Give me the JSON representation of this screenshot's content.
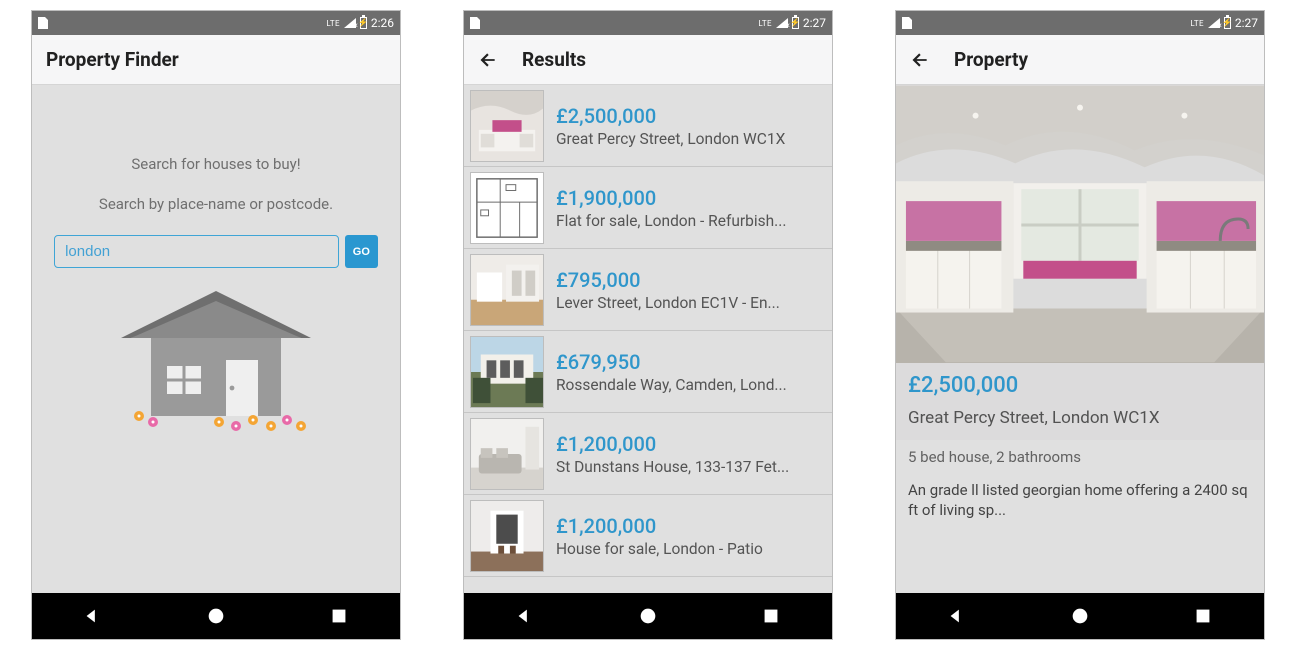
{
  "colors": {
    "accent": "#2f96cb",
    "statusbar": "#6d6d6d",
    "bg": "#e0e0e0"
  },
  "screen1": {
    "status_time": "2:26",
    "status_net": "LTE",
    "title": "Property Finder",
    "headline": "Search for houses to buy!",
    "subline": "Search by place-name or postcode.",
    "search_value": "london",
    "go_label": "GO"
  },
  "screen2": {
    "status_time": "2:27",
    "status_net": "LTE",
    "title": "Results",
    "items": [
      {
        "price": "£2,500,000",
        "address": "Great Percy Street, London WC1X"
      },
      {
        "price": "£1,900,000",
        "address": "Flat for sale, London - Refurbish..."
      },
      {
        "price": "£795,000",
        "address": "Lever Street, London EC1V - En..."
      },
      {
        "price": "£679,950",
        "address": "Rossendale Way, Camden, Lond..."
      },
      {
        "price": "£1,200,000",
        "address": "St Dunstans House, 133-137 Fet..."
      },
      {
        "price": "£1,200,000",
        "address": "House for sale, London - Patio"
      }
    ]
  },
  "screen3": {
    "status_time": "2:27",
    "status_net": "LTE",
    "title": "Property",
    "price": "£2,500,000",
    "address": "Great Percy Street, London WC1X",
    "summary": "5 bed house, 2 bathrooms",
    "description": "An grade ll listed georgian home offering a 2400 sq ft of living sp..."
  }
}
